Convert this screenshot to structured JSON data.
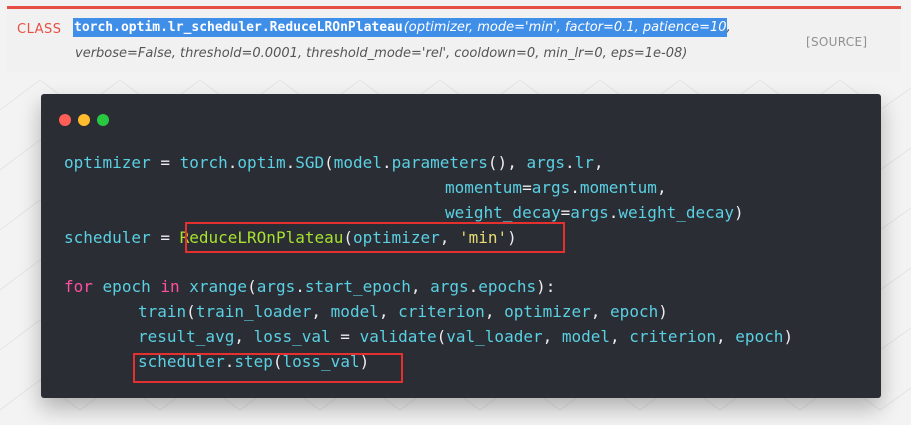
{
  "doc": {
    "class_label": "CLASS",
    "signature_name": "torch.optim.lr_scheduler.ReduceLROnPlateau",
    "signature_params_highlighted": "(optimizer, mode='min', factor=0.1, patience=10",
    "signature_params_line1_tail": ",",
    "signature_params_line2": "verbose=False, threshold=0.0001, threshold_mode='rel', cooldown=0, min_lr=0, eps=1e-08)",
    "source_link": "[SOURCE]"
  },
  "colors": {
    "accent": "#e65044",
    "selection": "#3f8ee8",
    "code_bg": "#2b2d34",
    "highlight_box": "#e53030"
  },
  "code": {
    "lines": [
      [
        "optimizer",
        " = ",
        "torch",
        ".",
        "optim",
        ".",
        "SGD",
        "(",
        "model",
        ".",
        "parameters",
        "(), ",
        "args",
        ".",
        "lr",
        ","
      ],
      [
        "momentum",
        "=",
        "args",
        ".",
        "momentum",
        ","
      ],
      [
        "weight_decay",
        "=",
        "args",
        ".",
        "weight_decay",
        ")"
      ],
      [
        "scheduler",
        " = ",
        "ReduceLROnPlateau",
        "(",
        "optimizer",
        ", ",
        "'min'",
        ")"
      ],
      [
        "for",
        " ",
        "epoch",
        " ",
        "in",
        " ",
        "xrange",
        "(",
        "args",
        ".",
        "start_epoch",
        ", ",
        "args",
        ".",
        "epochs",
        "):"
      ],
      [
        "train",
        "(",
        "train_loader",
        ", ",
        "model",
        ", ",
        "criterion",
        ", ",
        "optimizer",
        ", ",
        "epoch",
        ")"
      ],
      [
        "result_avg",
        ", ",
        "loss_val",
        " = ",
        "validate",
        "(",
        "val_loader",
        ", ",
        "model",
        ", ",
        "criterion",
        ", ",
        "epoch",
        ")"
      ],
      [
        "scheduler",
        ".",
        "step",
        "(",
        "loss_val",
        ")"
      ]
    ]
  }
}
